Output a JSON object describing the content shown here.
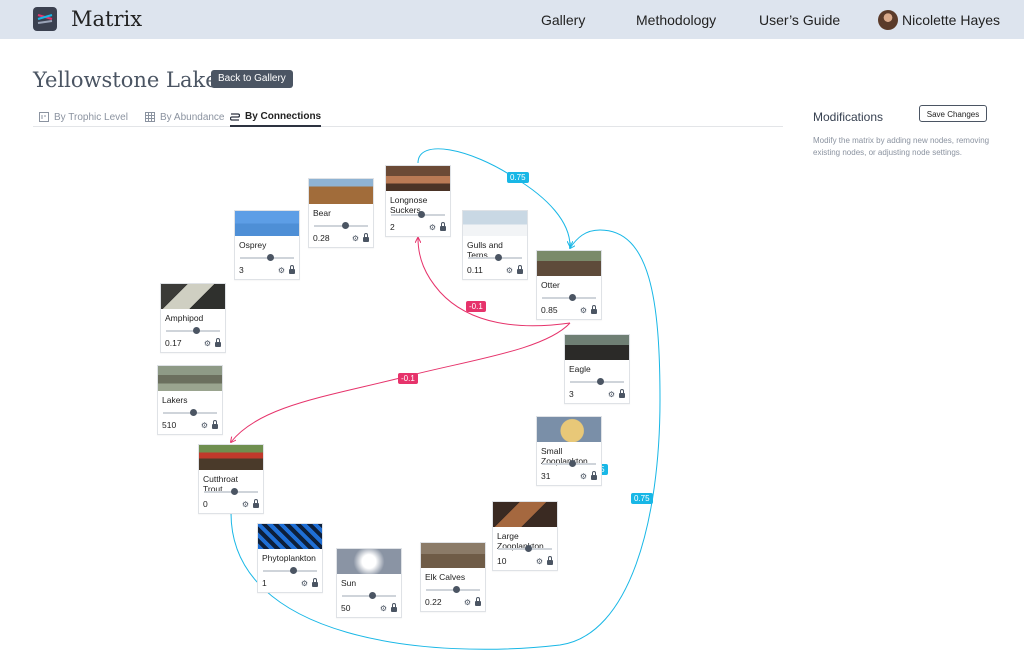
{
  "app": {
    "title": "Matrix"
  },
  "nav": {
    "gallery": "Gallery",
    "methodology": "Methodology",
    "guide": "User’s Guide",
    "user_name": "Nicolette Hayes"
  },
  "page": {
    "title": "Yellowstone Lake",
    "back_label": "Back to Gallery"
  },
  "tabs": [
    {
      "label": "By Trophic Level",
      "active": false
    },
    {
      "label": "By Abundance",
      "active": false
    },
    {
      "label": "By Connections",
      "active": true
    }
  ],
  "modifications": {
    "title": "Modifications",
    "save_label": "Save Changes",
    "description": "Modify the matrix by adding new nodes, removing existing nodes, or adjusting node settings."
  },
  "edges": [
    {
      "from": "Longnose Suckers",
      "to": "Otter",
      "weight": "0.75",
      "color": "#18b7e6"
    },
    {
      "from": "Otter",
      "to": "Longnose Suckers",
      "weight": "-0.1",
      "color": "#e6336b"
    },
    {
      "from": "Otter",
      "to": "Cutthroat Trout",
      "weight": "-0.1",
      "color": "#e6336b"
    },
    {
      "from": "Cutthroat Trout",
      "to": "Otter",
      "weight": "0.75",
      "color": "#18b7e6"
    },
    {
      "from": "Small Zooplankton",
      "to": "",
      "weight": "0.75",
      "color": "#18b7e6"
    }
  ],
  "nodes": [
    {
      "id": "bear",
      "name": "Bear",
      "value": "0.28",
      "slider": 0.5,
      "locked": true
    },
    {
      "id": "suckers",
      "name": "Longnose Suckers",
      "value": "2",
      "slider": 0.5,
      "locked": true
    },
    {
      "id": "osprey",
      "name": "Osprey",
      "value": "3",
      "slider": 0.5,
      "locked": true
    },
    {
      "id": "gulls",
      "name": "Gulls and Terns",
      "value": "0.11",
      "slider": 0.5,
      "locked": true
    },
    {
      "id": "otter",
      "name": "Otter",
      "value": "0.85",
      "slider": 0.5,
      "locked": true
    },
    {
      "id": "amphipod",
      "name": "Amphipod",
      "value": "0.17",
      "slider": 0.5,
      "locked": true
    },
    {
      "id": "eagle",
      "name": "Eagle",
      "value": "3",
      "slider": 0.5,
      "locked": true
    },
    {
      "id": "lakers",
      "name": "Lakers",
      "value": "510",
      "slider": 0.5,
      "locked": false
    },
    {
      "id": "smallzoo",
      "name": "Small Zooplankton",
      "value": "31",
      "slider": 0.5,
      "locked": true
    },
    {
      "id": "trout",
      "name": "Cutthroat Trout",
      "value": "0",
      "slider": 0.5,
      "locked": false
    },
    {
      "id": "largezoo",
      "name": "Large Zooplankton",
      "value": "10",
      "slider": 0.5,
      "locked": true
    },
    {
      "id": "phyto",
      "name": "Phytoplankton",
      "value": "1",
      "slider": 0.5,
      "locked": true
    },
    {
      "id": "sun",
      "name": "Sun",
      "value": "50",
      "slider": 0.5,
      "locked": true
    },
    {
      "id": "elk",
      "name": "Elk Calves",
      "value": "0.22",
      "slider": 0.5,
      "locked": true
    }
  ]
}
